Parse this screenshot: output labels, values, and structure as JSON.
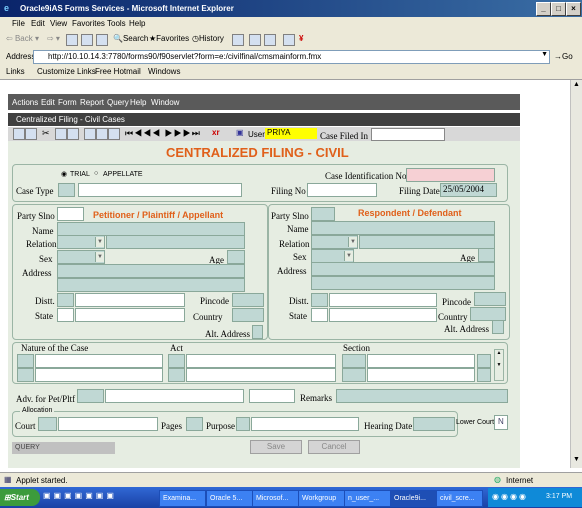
{
  "window": {
    "title": "Oracle9iAS Forms Services - Microsoft Internet Explorer"
  },
  "ie_menu": [
    "File",
    "Edit",
    "View",
    "Favorites",
    "Tools",
    "Help"
  ],
  "ie_toolbar": {
    "back": "Back",
    "search": "Search",
    "favorites": "Favorites",
    "history": "History"
  },
  "address": {
    "label": "Address",
    "url": "http://10.10.14.3:7780/forms90/f90servlet?form=e:/civilfinal/cmsmainform.fmx",
    "go": "Go"
  },
  "links": {
    "label": "Links",
    "items": [
      "Customize Links",
      "Free Hotmail",
      "Windows"
    ]
  },
  "forms_menu": [
    "Actions",
    "Edit",
    "Form",
    "Report",
    "Query",
    "Help",
    "Window"
  ],
  "child_title": "Centralized Filing - Civil Cases",
  "form_toolbar": {
    "user_label": "User",
    "user_value": "PRIYA",
    "case_filed_label": "Case Filed In"
  },
  "form": {
    "title": "CENTRALIZED FILING - CIVIL",
    "radio_trial": "TRIAL",
    "radio_appellate": "APPELLATE",
    "case_type_label": "Case Type",
    "case_id_label": "Case Identification No",
    "filing_no_label": "Filing No",
    "filing_date_label": "Filing Date",
    "filing_date_value": "25/05/2004",
    "petitioner": {
      "heading": "Petitioner / Plaintiff / Appellant",
      "party_slno": "Party Slno",
      "name": "Name",
      "relation": "Relation",
      "sex": "Sex",
      "age": "Age",
      "address": "Address",
      "distt": "Distt.",
      "pincode": "Pincode",
      "state": "State",
      "country": "Country",
      "alt_address": "Alt. Address"
    },
    "respondent": {
      "heading": "Respondent / Defendant",
      "party_slno": "Party Slno",
      "name": "Name",
      "relation": "Relation",
      "sex": "Sex",
      "age": "Age",
      "address": "Address",
      "distt": "Distt.",
      "pincode": "Pincode",
      "state": "State",
      "country": "Country",
      "alt_address": "Alt. Address"
    },
    "nature_label": "Nature of the Case",
    "act_label": "Act",
    "section_label": "Section",
    "adv_label": "Adv. for Pet/Pltf",
    "remarks_label": "Remarks",
    "allocation_label": "Allocation",
    "court_label": "Court",
    "pages_label": "Pages",
    "purpose_label": "Purpose",
    "hearing_label": "Hearing Date",
    "lower_court_label": "Lower Court",
    "lower_court_value": "N",
    "mode_label": "QUERY",
    "save_button": "Save",
    "cancel_button": "Cancel"
  },
  "statusbar": {
    "left": "Applet started.",
    "zone": "Internet"
  },
  "taskbar": {
    "start": "Start",
    "tasks": [
      "Examina...",
      "Oracle 5...",
      "Microsof...",
      "Workgroup",
      "n_user_...",
      "Oracle9i...",
      "civil_scre..."
    ],
    "clock": "3:17 PM"
  },
  "colors": {
    "title_bg": "#0a246a",
    "form_bg": "#e6ede2",
    "heading": "#e0601a",
    "field_gray": "#c0d8d4",
    "field_pink": "#f6d0d4"
  }
}
